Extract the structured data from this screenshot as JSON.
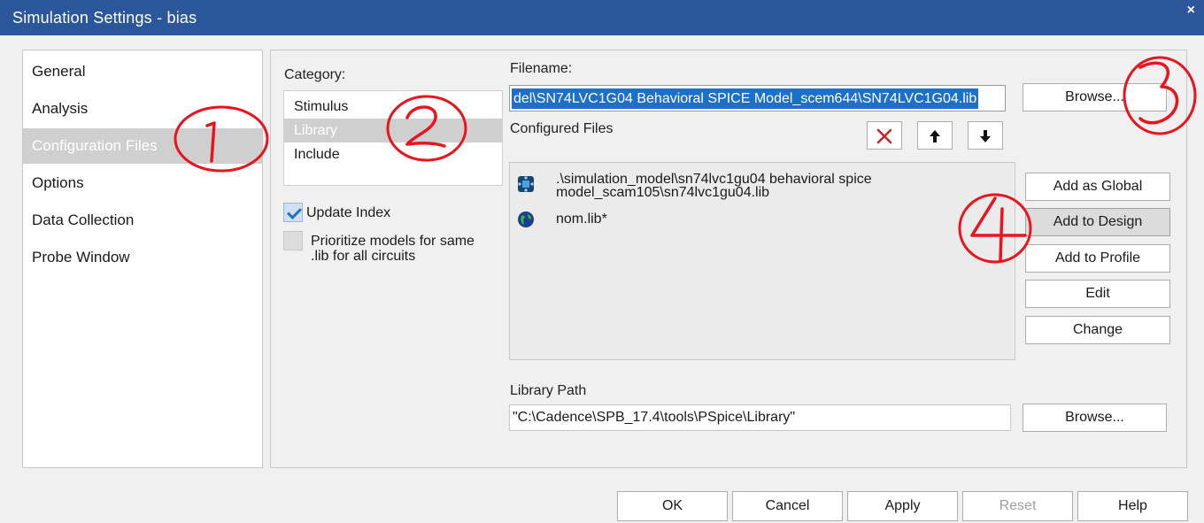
{
  "window": {
    "title": "Simulation Settings - bias",
    "close_glyph": "×"
  },
  "nav": {
    "items": [
      {
        "label": "General"
      },
      {
        "label": "Analysis"
      },
      {
        "label": "Configuration Files",
        "selected": true
      },
      {
        "label": "Options"
      },
      {
        "label": "Data Collection"
      },
      {
        "label": "Probe Window"
      }
    ]
  },
  "category": {
    "label": "Category:",
    "items": [
      {
        "label": "Stimulus"
      },
      {
        "label": "Library",
        "selected": true
      },
      {
        "label": "Include"
      }
    ]
  },
  "options": {
    "update_index": {
      "label": "Update Index",
      "checked": true
    },
    "prioritize": {
      "label": "Prioritize models for same\n.lib for all circuits",
      "checked": false
    }
  },
  "filename": {
    "label": "Filename:",
    "value": "del\\SN74LVC1G04 Behavioral SPICE Model_scem644\\SN74LVC1G04.lib",
    "browse_label": "Browse..."
  },
  "configured": {
    "label": "Configured Files",
    "toolbar": {
      "delete_icon": "delete-x-icon",
      "up_icon": "arrow-up-icon",
      "down_icon": "arrow-down-icon"
    },
    "files": [
      {
        "icon": "design-library-icon",
        "text": ".\\simulation_model\\sn74lvc1gu04 behavioral spice\nmodel_scam105\\sn74lvc1gu04.lib"
      },
      {
        "icon": "global-library-icon",
        "text": "nom.lib*"
      }
    ]
  },
  "actions": {
    "add_global": "Add as Global",
    "add_design": "Add to Design",
    "add_profile": "Add to Profile",
    "edit": "Edit",
    "change": "Change"
  },
  "library_path": {
    "label": "Library Path",
    "value": "\"C:\\Cadence\\SPB_17.4\\tools\\PSpice\\Library\"",
    "browse_label": "Browse..."
  },
  "footer": {
    "ok": "OK",
    "cancel": "Cancel",
    "apply": "Apply",
    "reset": "Reset",
    "help": "Help"
  },
  "colors": {
    "titlebar": "#2b579a",
    "selection": "#1e6fc7",
    "annotation": "#e8141e"
  }
}
